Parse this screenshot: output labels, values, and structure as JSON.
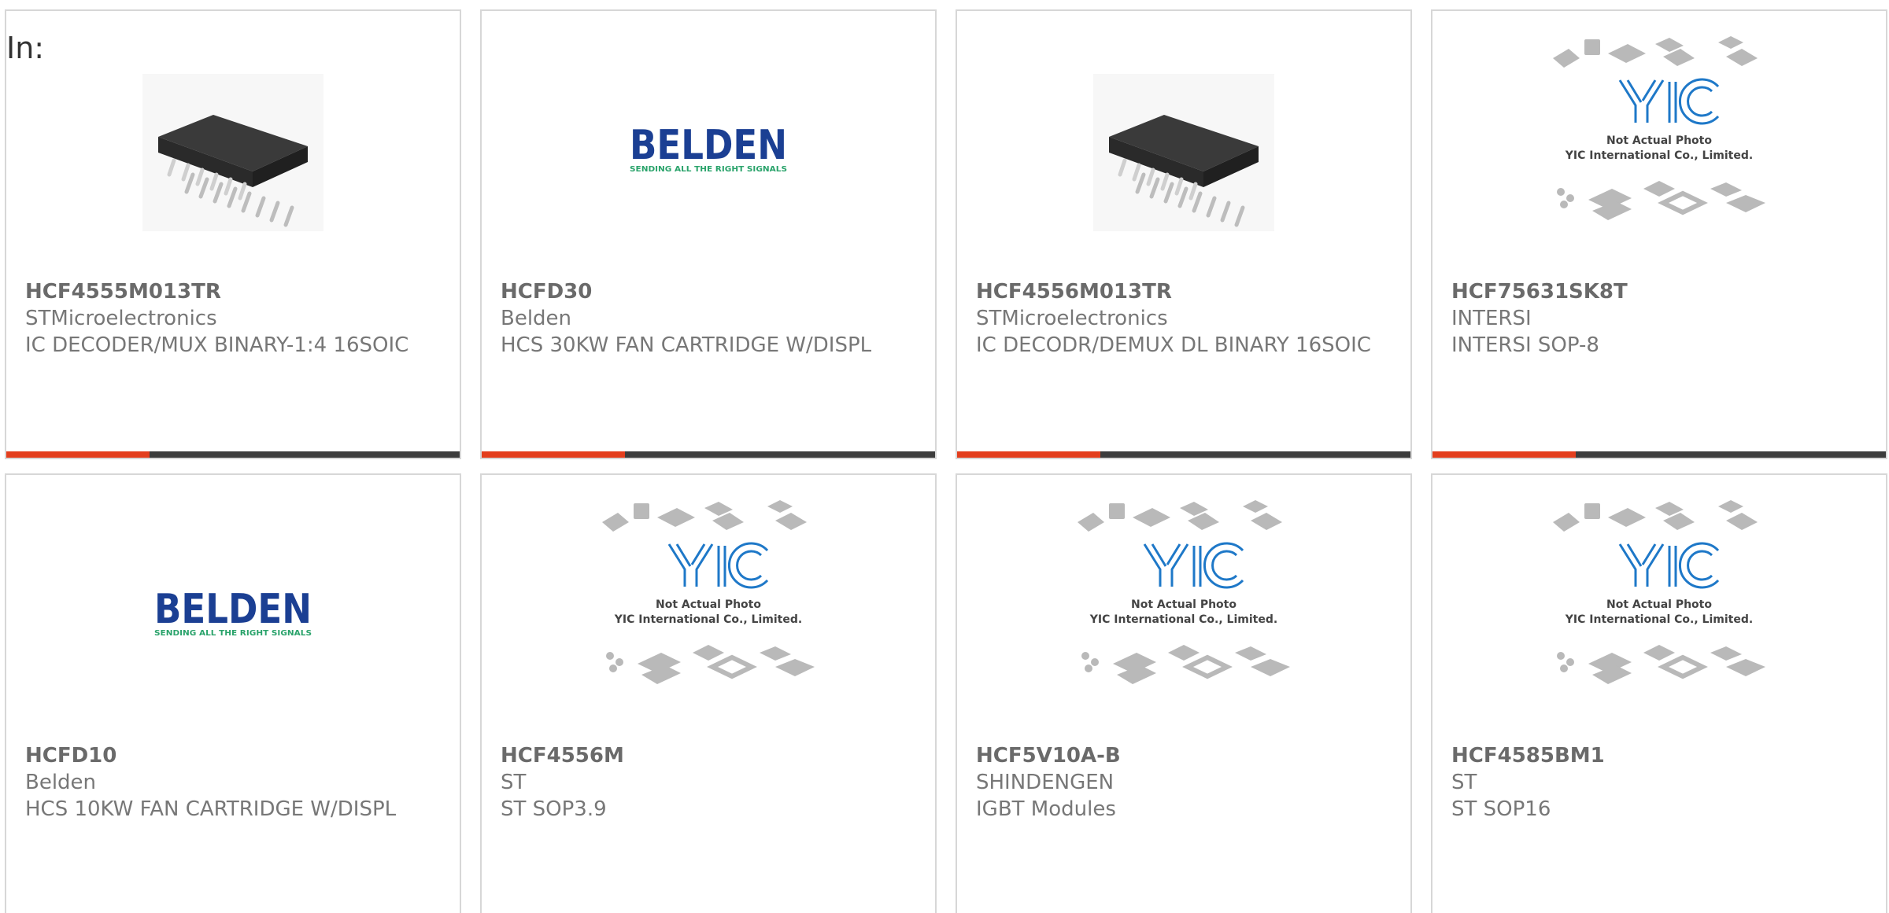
{
  "page": {
    "label": "In:"
  },
  "colors": {
    "card_border": "#d7d7d7",
    "accent": "#e33e1d",
    "bar": "#3c3c3c",
    "text": "#777777",
    "belden_blue": "#1b3f93",
    "belden_green": "#2aa36b",
    "yic_blue": "#1e78c8"
  },
  "products": [
    {
      "part": "HCF4555M013TR",
      "manufacturer": "STMicroelectronics",
      "description": "IC DECODER/MUX BINARY-1:4 16SOIC",
      "image": "soic-chip-photo"
    },
    {
      "part": "HCFD30",
      "manufacturer": "Belden",
      "description": "HCS 30KW FAN CARTRIDGE W/DISPL",
      "image": "belden-logo",
      "logo_name": "BELDEN",
      "logo_tagline": "SENDING ALL THE RIGHT SIGNALS"
    },
    {
      "part": "HCF4556M013TR",
      "manufacturer": "STMicroelectronics",
      "description": "IC DECODR/DEMUX DL BINARY 16SOIC",
      "image": "soic-chip-photo"
    },
    {
      "part": "HCF75631SK8T",
      "manufacturer": "INTERSI",
      "description": "INTERSI SOP-8",
      "image": "yic-placeholder",
      "placeholder_line1": "Not Actual Photo",
      "placeholder_line2": "YIC International Co., Limited."
    },
    {
      "part": "HCFD10",
      "manufacturer": "Belden",
      "description": "HCS 10KW FAN CARTRIDGE W/DISPL",
      "image": "belden-logo",
      "logo_name": "BELDEN",
      "logo_tagline": "SENDING ALL THE RIGHT SIGNALS"
    },
    {
      "part": "HCF4556M",
      "manufacturer": "ST",
      "description": "ST SOP3.9",
      "image": "yic-placeholder",
      "placeholder_line1": "Not Actual Photo",
      "placeholder_line2": "YIC International Co., Limited."
    },
    {
      "part": "HCF5V10A-B",
      "manufacturer": "SHINDENGEN",
      "description": "IGBT Modules",
      "image": "yic-placeholder",
      "placeholder_line1": "Not Actual Photo",
      "placeholder_line2": "YIC International Co., Limited."
    },
    {
      "part": "HCF4585BM1",
      "manufacturer": "ST",
      "description": "ST SOP16",
      "image": "yic-placeholder",
      "placeholder_line1": "Not Actual Photo",
      "placeholder_line2": "YIC International Co., Limited."
    }
  ]
}
